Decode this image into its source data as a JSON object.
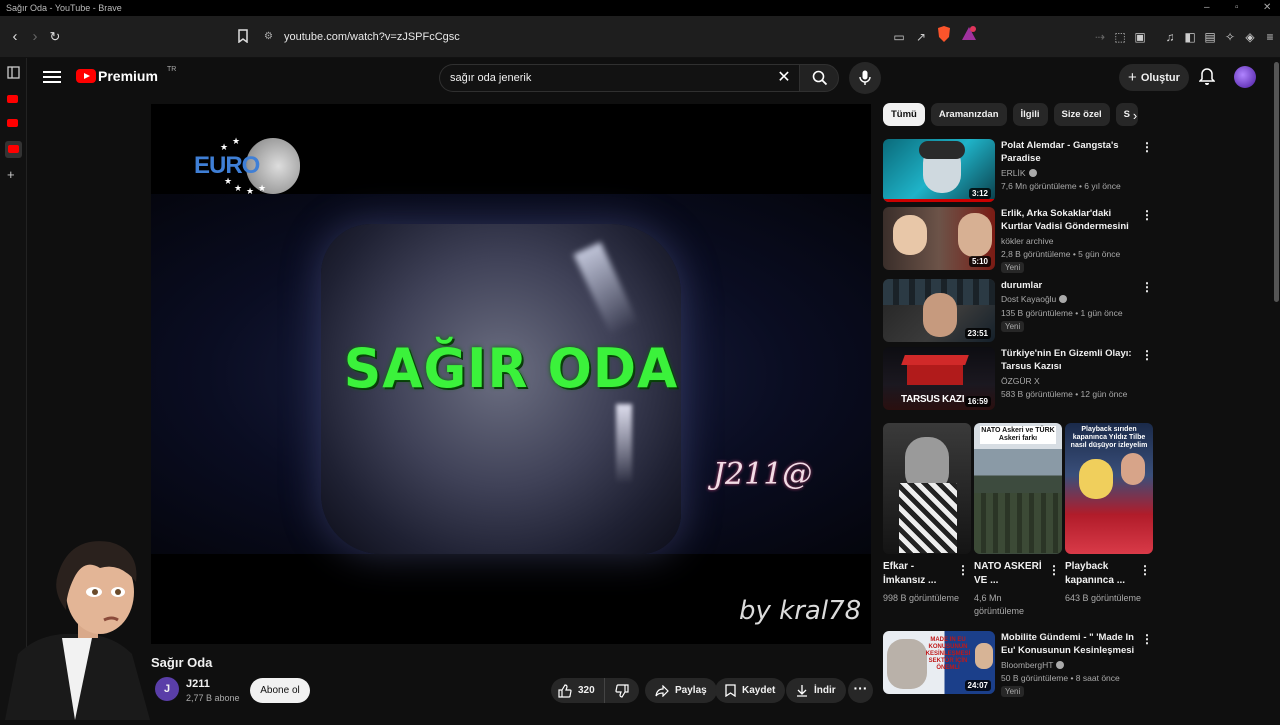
{
  "window": {
    "title": "Sağır Oda - YouTube - Brave"
  },
  "browser": {
    "url": "youtube.com/watch?v=zJSPFcCgsc"
  },
  "header": {
    "logo_text": "Premium",
    "logo_sup": "TR",
    "search_value": "sağır oda jenerik",
    "create_label": "Oluştur"
  },
  "video": {
    "overlay_title": "SAĞIR ODA",
    "channel_logo_text": "EURO",
    "watermark_signature": "J211@",
    "watermark_by": "by kral78",
    "title": "Sağır Oda",
    "channel_initial": "J",
    "channel_name": "J211",
    "subscribers": "2,77 B abone",
    "subscribe_label": "Abone ol",
    "likes": "320",
    "share_label": "Paylaş",
    "save_label": "Kaydet",
    "download_label": "İndir"
  },
  "chips": [
    "Tümü",
    "Aramanızdan",
    "İlgili",
    "Size özel",
    "S"
  ],
  "recommendations": [
    {
      "title": "Polat Alemdar - Gangsta's Paradise",
      "channel": "ERLİK",
      "meta": "7,6 Mn görüntüleme • 6 yıl önce",
      "duration": "3:12",
      "badge": ""
    },
    {
      "title": "Erlik, Arka Sokaklar'daki Kurtlar Vadisi Göndermesini İzliyor | ...",
      "channel": "kökler archive",
      "meta": "2,8 B görüntüleme • 5 gün önce",
      "duration": "5:10",
      "badge": "Yeni"
    },
    {
      "title": "durumlar",
      "channel": "Dost Kayaoğlu",
      "meta": "135 B görüntüleme • 1 gün önce",
      "duration": "23:51",
      "badge": "Yeni"
    },
    {
      "title": "Türkiye'nin En Gizemli Olayı: Tarsus Kazısı",
      "channel": "ÖZGÜR X",
      "meta": "583 B görüntüleme • 12 gün önce",
      "duration": "16:59",
      "badge": "",
      "thumb_text": "TARSUS KAZI"
    },
    {
      "title": "Mobilite Gündemi - \" 'Made In Eu' Konusunun Kesinleşmesi ...",
      "channel": "BloombergHT",
      "meta": "50 B görüntüleme • 8 saat önce",
      "duration": "24:07",
      "badge": "Yeni",
      "thumb_text": "MADE IN EU KONUSUNUN KESİNLEŞMESİ SEKTÖR İÇİN ÖNEMLİ"
    }
  ],
  "shorts": [
    {
      "title": "Efkar - İmkansız ...",
      "views": "998 B görüntüleme"
    },
    {
      "title": "NATO ASKERİ VE ...",
      "views": "4,6 Mn görüntüleme",
      "thumb_text": "NATO Askeri ve TÜRK Askeri farkı"
    },
    {
      "title": "Playback kapanınca ...",
      "views": "643 B görüntüleme",
      "thumb_text": "Playback sırıden kapanınca Yıldız Tilbe nasıl düşüyor izleyelim"
    }
  ],
  "colors": {
    "accent": "#ff0000",
    "overlay_green": "#3bf23b",
    "bg": "#0f0f0f"
  }
}
